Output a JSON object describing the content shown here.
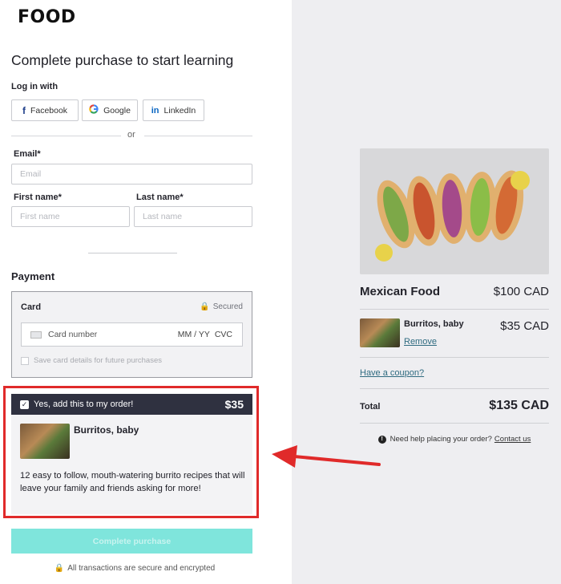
{
  "brand": {
    "logo_text": "FOOD"
  },
  "checkout": {
    "title": "Complete purchase to start learning",
    "login_label": "Log in with",
    "social": [
      {
        "label": "Facebook",
        "icon": "facebook-icon"
      },
      {
        "label": "Google",
        "icon": "google-icon"
      },
      {
        "label": "LinkedIn",
        "icon": "linkedin-icon"
      }
    ],
    "or_text": "or",
    "email": {
      "label": "Email*",
      "placeholder": "Email"
    },
    "first_name": {
      "label": "First name*",
      "placeholder": "First name"
    },
    "last_name": {
      "label": "Last name*",
      "placeholder": "Last name"
    }
  },
  "payment": {
    "heading": "Payment",
    "card_label": "Card",
    "secured_text": "Secured",
    "card_number_placeholder": "Card number",
    "expiry_placeholder": "MM / YY",
    "cvc_placeholder": "CVC",
    "save_card_text": "Save card details for future purchases"
  },
  "order_bump": {
    "checkbox_text": "Yes, add this to my order!",
    "price": "$35",
    "product_name": "Burritos, baby",
    "description": "12 easy to follow, mouth-watering burrito recipes that will leave your family and friends asking for more!",
    "checked": true
  },
  "actions": {
    "complete_label": "Complete purchase",
    "secure_note": "All transactions are secure and encrypted"
  },
  "summary": {
    "product_title": "Mexican Food",
    "product_price": "$100 CAD",
    "item_name": "Burritos, baby",
    "item_price": "$35 CAD",
    "remove_label": "Remove",
    "coupon_label": "Have a coupon?",
    "total_label": "Total",
    "total_value": "$135 CAD",
    "help_text": "Need help placing your order?",
    "help_link": "Contact us"
  },
  "colors": {
    "highlight": "#e02a2a",
    "bump_bar": "#2f3140",
    "cta": "#7fe5dc",
    "summary_bg": "#eeeef1",
    "link": "#2f6b80"
  }
}
